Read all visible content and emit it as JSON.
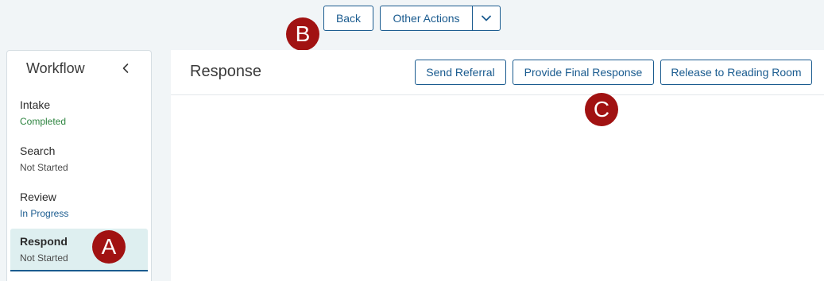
{
  "toolbar": {
    "back_label": "Back",
    "other_actions_label": "Other Actions",
    "other_actions_icon": "chevron-down-icon"
  },
  "markers": {
    "a": "A",
    "b": "B",
    "c": "C"
  },
  "sidebar": {
    "title": "Workflow",
    "collapse_icon": "chevron-left-icon",
    "steps": [
      {
        "name": "Intake",
        "status": "Completed"
      },
      {
        "name": "Search",
        "status": "Not Started"
      },
      {
        "name": "Review",
        "status": "In Progress"
      },
      {
        "name": "Respond",
        "status": "Not Started"
      }
    ]
  },
  "main": {
    "title": "Response",
    "actions": {
      "send_referral": "Send Referral",
      "final_response": "Provide Final Response",
      "release": "Release to Reading Room"
    }
  },
  "colors": {
    "accent": "#1a5b8f",
    "marker": "#a11212",
    "completed": "#2e8540",
    "active_step_bg": "#deeff0",
    "page_bg": "#f1f5f7"
  }
}
